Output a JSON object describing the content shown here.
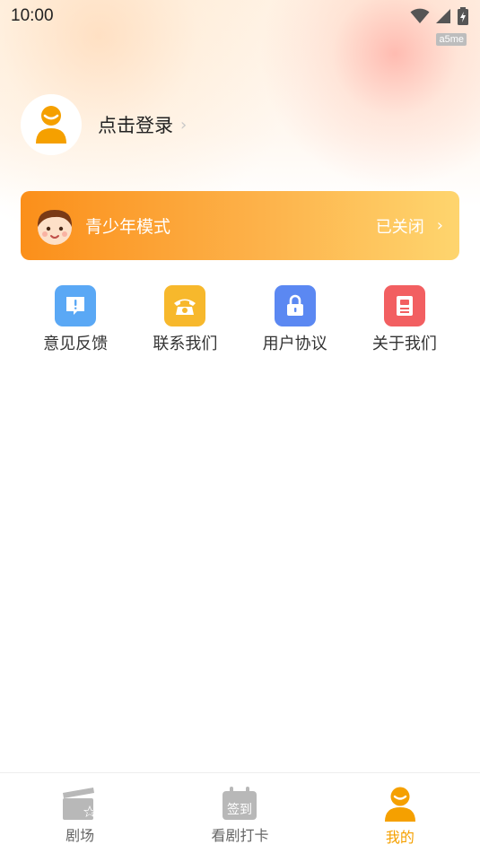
{
  "status_bar": {
    "time": "10:00",
    "watermark": "a5me"
  },
  "profile": {
    "login_label": "点击登录",
    "chevron": "›"
  },
  "youth_mode": {
    "title": "青少年模式",
    "status": "已关闭",
    "chevron": "›"
  },
  "quick_links": [
    {
      "label": "意见反馈",
      "icon": "feedback-icon",
      "color": "#5aa8f5"
    },
    {
      "label": "联系我们",
      "icon": "phone-icon",
      "color": "#f7b82c"
    },
    {
      "label": "用户协议",
      "icon": "lock-icon",
      "color": "#5b88f2"
    },
    {
      "label": "关于我们",
      "icon": "book-icon",
      "color": "#f25f61"
    }
  ],
  "tabbar": {
    "items": [
      {
        "label": "剧场",
        "icon": "clapperboard-icon",
        "active": false
      },
      {
        "label": "看剧打卡",
        "icon": "calendar-checkin-icon",
        "badge": "签到",
        "active": false
      },
      {
        "label": "我的",
        "icon": "user-icon",
        "active": true
      }
    ]
  },
  "colors": {
    "accent": "#f5a000",
    "banner_start": "#fb8f1a",
    "banner_end": "#fed56e"
  }
}
